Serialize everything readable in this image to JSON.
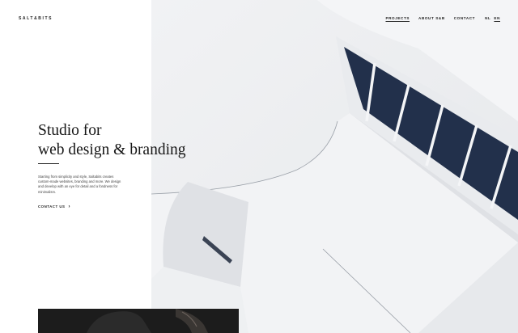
{
  "header": {
    "logo": "SALT&BITS",
    "nav": [
      {
        "label": "PROJECTS",
        "active": true
      },
      {
        "label": "ABOUT S&B",
        "active": false
      },
      {
        "label": "CONTACT",
        "active": false
      }
    ],
    "languages": [
      {
        "label": "NL",
        "active": false
      },
      {
        "label": "EN",
        "active": true
      }
    ]
  },
  "hero": {
    "headline_line1": "Studio for",
    "headline_line2": "web design & branding",
    "intro": "Starting from simplicity and style, Saltabits creates custom-made websites, branding and more. We design and develop with an eye for detail and a fondness for minimalism.",
    "cta_label": "CONTACT US",
    "cta_icon": "chevron-right-icon"
  },
  "colors": {
    "text": "#161616",
    "window_frame": "#1f2c45",
    "photo_bg": "#eceef1"
  }
}
